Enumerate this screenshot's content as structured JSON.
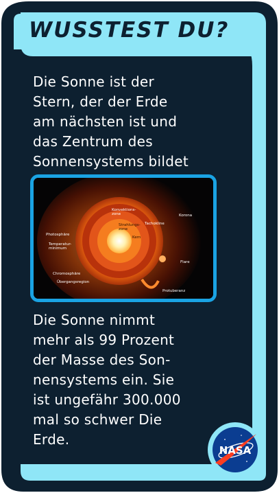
{
  "card": {
    "title": "WUSSTEST DU?",
    "paragraph_1": "Die Sonne ist der\nStern, der der Erde\nam nächsten ist und\ndas Zentrum des\nSonnensystems bildet",
    "paragraph_2": "Die Sonne nimmt\nmehr als 99 Prozent\nder Masse des Son-\nnensystems ein. Sie\nist ungefähr 300.000\nmal so schwer Die\nErde.",
    "colors": {
      "frame": "#0d2030",
      "accent": "#8fe6f7",
      "image_border": "#1aa3e3",
      "text": "#ffffff"
    }
  },
  "sun_diagram": {
    "labels": {
      "convection_zone": "Konvektions-\nzone",
      "radiation_zone": "Strahlungs-\nzone",
      "core": "Kern",
      "tachocline": "Tachokline",
      "corona": "Korona",
      "photosphere": "Photosphäre",
      "temperature_minimum": "Temperatur-\nminimum",
      "chromosphere": "Chromosphäre",
      "transition_region": "Übergangsregion",
      "flare": "Flare",
      "prominence": "Protuberanz"
    }
  },
  "logo": {
    "icon": "nasa-logo",
    "text": "NASA"
  }
}
